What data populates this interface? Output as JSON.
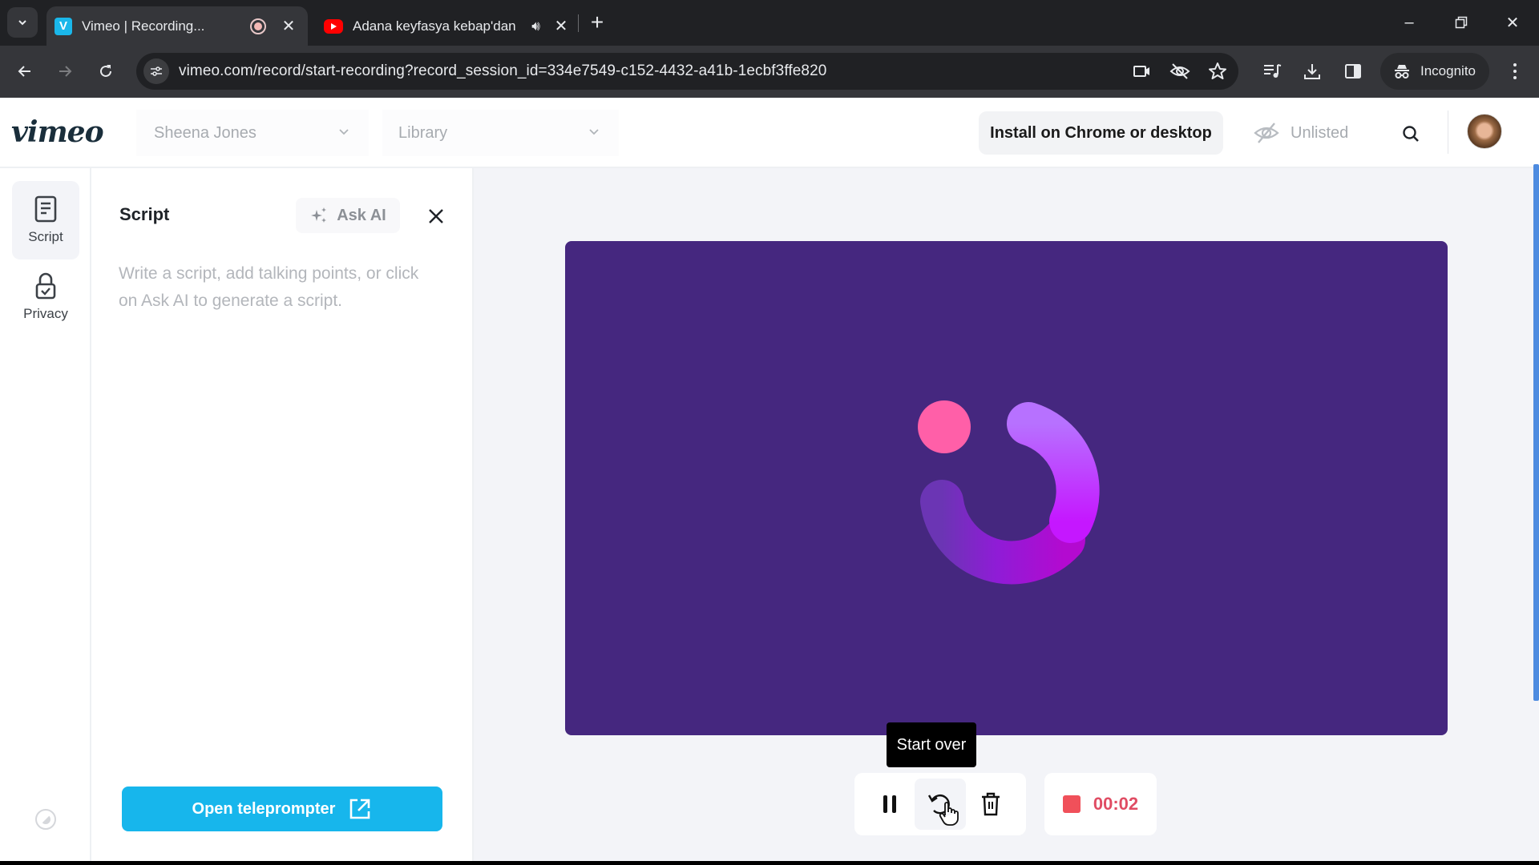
{
  "browser": {
    "tabs": [
      {
        "title": "Vimeo | Recording...",
        "favicon": "vimeo-icon",
        "recording": true,
        "active": true
      },
      {
        "title": "Adana keyfasya kebap'dan",
        "favicon": "youtube-icon",
        "playing_audio": true,
        "active": false
      }
    ],
    "new_tab_label": "+",
    "url": "vimeo.com/record/start-recording?record_session_id=334e7549-c152-4432-a41b-1ecbf3ffe820",
    "incognito_label": "Incognito",
    "window_controls": {
      "minimize": "–",
      "restore": "❐",
      "close": "✕"
    }
  },
  "header": {
    "logo": "vimeo",
    "owner_dropdown": "Sheena Jones",
    "library_dropdown": "Library",
    "install_button": "Install on Chrome or desktop",
    "privacy_status": "Unlisted"
  },
  "rail": {
    "items": [
      {
        "label": "Script",
        "icon": "document-icon",
        "active": true
      },
      {
        "label": "Privacy",
        "icon": "lock-icon",
        "active": false
      }
    ]
  },
  "script_panel": {
    "title": "Script",
    "ask_ai_label": "Ask AI",
    "placeholder": "Write a script, add talking points, or click on Ask AI to generate a script.",
    "teleprompter_button": "Open teleprompter"
  },
  "recorder": {
    "tooltip": "Start over",
    "timer": "00:02",
    "controls": [
      "pause",
      "start-over",
      "delete"
    ],
    "stop_label": "stop",
    "colors": {
      "preview_bg": "#45277f",
      "accent": "#17b6ec",
      "record_red": "#f0505a",
      "timer_text": "#e04c63",
      "dot_pink": "#ff5fa8"
    }
  }
}
